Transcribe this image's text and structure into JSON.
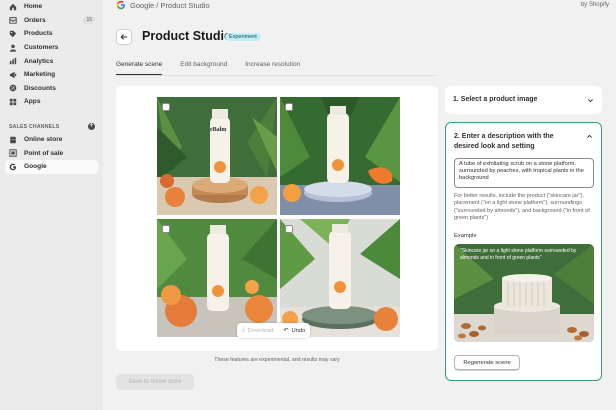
{
  "sidebar": {
    "items": [
      {
        "label": "Home",
        "icon": "home-icon"
      },
      {
        "label": "Orders",
        "icon": "orders-icon",
        "badge": "15"
      },
      {
        "label": "Products",
        "icon": "tag-icon"
      },
      {
        "label": "Customers",
        "icon": "person-icon"
      },
      {
        "label": "Analytics",
        "icon": "chart-icon"
      },
      {
        "label": "Marketing",
        "icon": "target-icon"
      },
      {
        "label": "Discounts",
        "icon": "discount-icon"
      },
      {
        "label": "Apps",
        "icon": "apps-icon"
      }
    ],
    "sales_channels_header": "SALES CHANNELS",
    "channels": [
      {
        "label": "Online store",
        "icon": "store-icon"
      },
      {
        "label": "Point of sale",
        "icon": "pos-icon"
      },
      {
        "label": "Google",
        "icon": "google-icon",
        "active": true
      }
    ]
  },
  "topbar": {
    "app_title": "Google / Product Studio",
    "by": "by Shopify"
  },
  "header": {
    "title": "Product Studio",
    "badge": "Experiment"
  },
  "tabs": [
    {
      "label": "Generate scene",
      "active": true
    },
    {
      "label": "Edit background",
      "active": false
    },
    {
      "label": "Increase resolution",
      "active": false
    }
  ],
  "product": {
    "brand": "eBalm"
  },
  "actions": {
    "download": "Download",
    "undo": "Undo"
  },
  "note": "These features are experimental, and results may vary",
  "save_button": "Save to online store",
  "steps": {
    "step1_title": "1. Select a product image",
    "step2_title": "2. Enter a description with the desired look and setting",
    "description": "A tube of exfoliating scrub on a stone platform, surrounded by peaches, with tropical plants in the background",
    "help": "For better results, include the product (\"skincare jar\"), placement (\"on a light stone platform\"), surroundings (\"surrounded by almonds\"), and background (\"in front of green plants\")",
    "example_label": "Example",
    "example_caption": "\"Skincare jar on a light stone platform surrounded by almonds and in front of green plants\"",
    "regenerate": "Regenerate scene"
  },
  "colors": {
    "accent_green": "#3d9b74",
    "badge_bg": "#c1eef5",
    "sidebar_bg": "#ebebeb"
  }
}
